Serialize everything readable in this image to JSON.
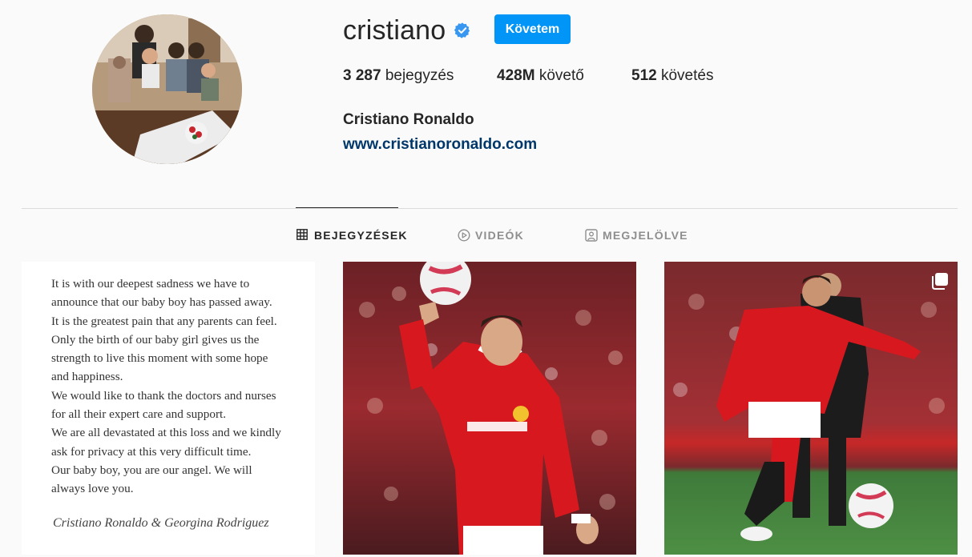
{
  "profile": {
    "username": "cristiano",
    "follow_label": "Követem",
    "full_name": "Cristiano Ronaldo",
    "website": "www.cristianoronaldo.com"
  },
  "stats": {
    "posts_count": "3 287",
    "posts_label": "bejegyzés",
    "followers_count": "428M",
    "followers_label": "követő",
    "following_count": "512",
    "following_label": "követés"
  },
  "tabs": [
    {
      "label": "BEJEGYZÉSEK",
      "icon": "grid-icon",
      "active": true
    },
    {
      "label": "VIDEÓK",
      "icon": "play-icon",
      "active": false
    },
    {
      "label": "MEGJELÖLVE",
      "icon": "tagged-icon",
      "active": false
    }
  ],
  "posts": [
    {
      "type": "text-image",
      "lines": [
        "It is with our deepest sadness we have to",
        "announce that our baby boy has passed away.",
        "It is the greatest pain that any parents can feel.",
        "Only the birth of our baby girl gives us the",
        "strength to live this moment with some hope",
        "and happiness.",
        "We would like to thank the doctors and nurses",
        "for all their expert care and support.",
        "We are all devastated at this loss and we kindly",
        "ask for privacy at this very difficult time.",
        "Our baby boy, you are our angel. We will",
        "always love you."
      ],
      "signature": "Cristiano Ronaldo & Georgina Rodriguez"
    },
    {
      "type": "photo",
      "icon": "player-photo"
    },
    {
      "type": "carousel",
      "icon": "player-photo",
      "badge_icon": "multiple-posts-icon"
    }
  ],
  "colors": {
    "accent": "#0095f6",
    "link": "#00376b",
    "verified": "#3897f0",
    "jersey_red": "#d7191f"
  }
}
